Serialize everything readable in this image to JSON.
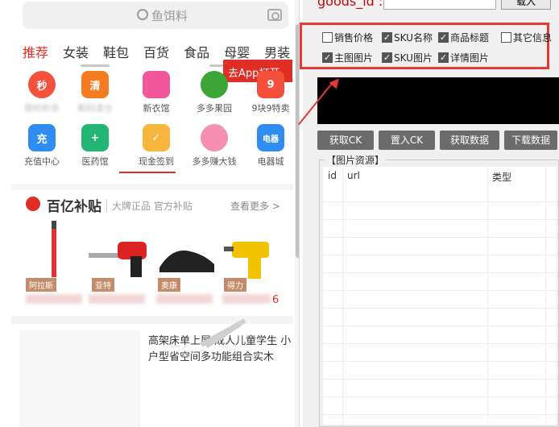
{
  "phone": {
    "search_text": "鱼饵料",
    "categories": [
      "推荐",
      "女装",
      "鞋包",
      "百货",
      "食品",
      "母婴",
      "男装"
    ],
    "app_banner": "去App打开 >",
    "grid": [
      {
        "label": "限时秒杀",
        "icon_text": "秒",
        "color": "#f5503b"
      },
      {
        "label": "断码清仓",
        "icon_text": "清",
        "color": "#f47b20"
      },
      {
        "label": "新衣馆",
        "icon_text": "",
        "color": "#f3569a"
      },
      {
        "label": "多多果园",
        "icon_text": "",
        "color": "#3ba635"
      },
      {
        "label": "9块9特卖",
        "icon_text": "9",
        "color": "#f5503b"
      },
      {
        "label": "充值中心",
        "icon_text": "充",
        "color": "#2f8cf0"
      },
      {
        "label": "医药馆",
        "icon_text": "+",
        "color": "#22b573"
      },
      {
        "label": "现金签到",
        "icon_text": "✓",
        "color": "#f6b73c"
      },
      {
        "label": "多多赚大钱",
        "icon_text": "",
        "color": "#f48fb1"
      },
      {
        "label": "电器城",
        "icon_text": "电器",
        "color": "#2f8cf0"
      }
    ],
    "bybt": {
      "title": "百亿补贴",
      "subtitle": "大牌正品 官方补贴",
      "more": "查看更多 >"
    },
    "product_tags": [
      "阿拉斯",
      "亚特",
      "奥康",
      "得力"
    ],
    "price_tail": "6",
    "product_text": "高架床单上层 成人儿童学生 小户型省空间多功能组合实木"
  },
  "tool": {
    "goods_id_label": "goods_id :",
    "load_button": "载入",
    "options": [
      {
        "label": "销售价格",
        "checked": false
      },
      {
        "label": "SKU名称",
        "checked": true
      },
      {
        "label": "商品标题",
        "checked": true
      },
      {
        "label": "其它信息",
        "checked": false
      },
      {
        "label": "主图图片",
        "checked": true
      },
      {
        "label": "SKU图片",
        "checked": true
      },
      {
        "label": "详情图片",
        "checked": true
      }
    ],
    "buttons": [
      "获取CK",
      "置入CK",
      "获取数据",
      "下载数据"
    ],
    "resource_legend": "【图片资源】",
    "columns": [
      "id",
      "url",
      "类型"
    ]
  },
  "colors": {
    "brand_red": "#e02e24",
    "annotation_red": "#e53935"
  }
}
